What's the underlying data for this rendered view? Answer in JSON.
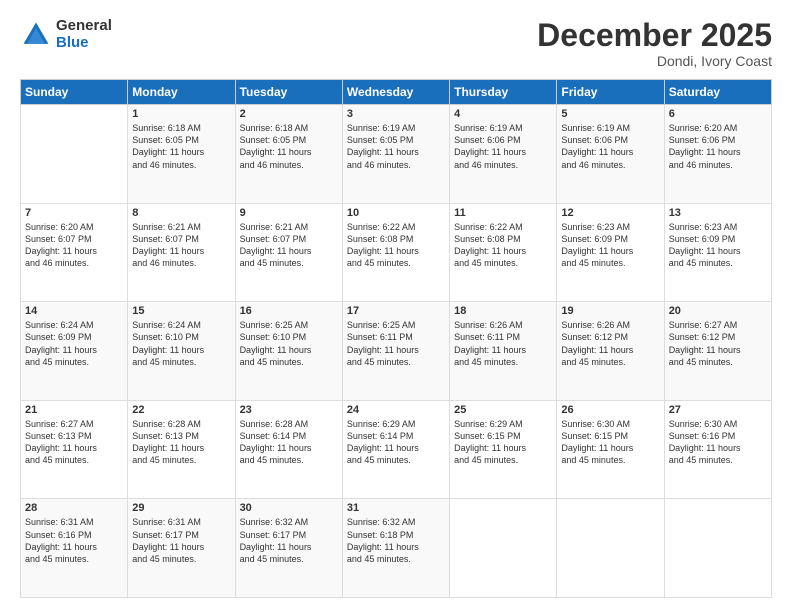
{
  "logo": {
    "general": "General",
    "blue": "Blue"
  },
  "title": "December 2025",
  "location": "Dondi, Ivory Coast",
  "days_of_week": [
    "Sunday",
    "Monday",
    "Tuesday",
    "Wednesday",
    "Thursday",
    "Friday",
    "Saturday"
  ],
  "weeks": [
    [
      {
        "day": "",
        "info": ""
      },
      {
        "day": "1",
        "info": "Sunrise: 6:18 AM\nSunset: 6:05 PM\nDaylight: 11 hours\nand 46 minutes."
      },
      {
        "day": "2",
        "info": "Sunrise: 6:18 AM\nSunset: 6:05 PM\nDaylight: 11 hours\nand 46 minutes."
      },
      {
        "day": "3",
        "info": "Sunrise: 6:19 AM\nSunset: 6:05 PM\nDaylight: 11 hours\nand 46 minutes."
      },
      {
        "day": "4",
        "info": "Sunrise: 6:19 AM\nSunset: 6:06 PM\nDaylight: 11 hours\nand 46 minutes."
      },
      {
        "day": "5",
        "info": "Sunrise: 6:19 AM\nSunset: 6:06 PM\nDaylight: 11 hours\nand 46 minutes."
      },
      {
        "day": "6",
        "info": "Sunrise: 6:20 AM\nSunset: 6:06 PM\nDaylight: 11 hours\nand 46 minutes."
      }
    ],
    [
      {
        "day": "7",
        "info": "Sunrise: 6:20 AM\nSunset: 6:07 PM\nDaylight: 11 hours\nand 46 minutes."
      },
      {
        "day": "8",
        "info": "Sunrise: 6:21 AM\nSunset: 6:07 PM\nDaylight: 11 hours\nand 46 minutes."
      },
      {
        "day": "9",
        "info": "Sunrise: 6:21 AM\nSunset: 6:07 PM\nDaylight: 11 hours\nand 45 minutes."
      },
      {
        "day": "10",
        "info": "Sunrise: 6:22 AM\nSunset: 6:08 PM\nDaylight: 11 hours\nand 45 minutes."
      },
      {
        "day": "11",
        "info": "Sunrise: 6:22 AM\nSunset: 6:08 PM\nDaylight: 11 hours\nand 45 minutes."
      },
      {
        "day": "12",
        "info": "Sunrise: 6:23 AM\nSunset: 6:09 PM\nDaylight: 11 hours\nand 45 minutes."
      },
      {
        "day": "13",
        "info": "Sunrise: 6:23 AM\nSunset: 6:09 PM\nDaylight: 11 hours\nand 45 minutes."
      }
    ],
    [
      {
        "day": "14",
        "info": "Sunrise: 6:24 AM\nSunset: 6:09 PM\nDaylight: 11 hours\nand 45 minutes."
      },
      {
        "day": "15",
        "info": "Sunrise: 6:24 AM\nSunset: 6:10 PM\nDaylight: 11 hours\nand 45 minutes."
      },
      {
        "day": "16",
        "info": "Sunrise: 6:25 AM\nSunset: 6:10 PM\nDaylight: 11 hours\nand 45 minutes."
      },
      {
        "day": "17",
        "info": "Sunrise: 6:25 AM\nSunset: 6:11 PM\nDaylight: 11 hours\nand 45 minutes."
      },
      {
        "day": "18",
        "info": "Sunrise: 6:26 AM\nSunset: 6:11 PM\nDaylight: 11 hours\nand 45 minutes."
      },
      {
        "day": "19",
        "info": "Sunrise: 6:26 AM\nSunset: 6:12 PM\nDaylight: 11 hours\nand 45 minutes."
      },
      {
        "day": "20",
        "info": "Sunrise: 6:27 AM\nSunset: 6:12 PM\nDaylight: 11 hours\nand 45 minutes."
      }
    ],
    [
      {
        "day": "21",
        "info": "Sunrise: 6:27 AM\nSunset: 6:13 PM\nDaylight: 11 hours\nand 45 minutes."
      },
      {
        "day": "22",
        "info": "Sunrise: 6:28 AM\nSunset: 6:13 PM\nDaylight: 11 hours\nand 45 minutes."
      },
      {
        "day": "23",
        "info": "Sunrise: 6:28 AM\nSunset: 6:14 PM\nDaylight: 11 hours\nand 45 minutes."
      },
      {
        "day": "24",
        "info": "Sunrise: 6:29 AM\nSunset: 6:14 PM\nDaylight: 11 hours\nand 45 minutes."
      },
      {
        "day": "25",
        "info": "Sunrise: 6:29 AM\nSunset: 6:15 PM\nDaylight: 11 hours\nand 45 minutes."
      },
      {
        "day": "26",
        "info": "Sunrise: 6:30 AM\nSunset: 6:15 PM\nDaylight: 11 hours\nand 45 minutes."
      },
      {
        "day": "27",
        "info": "Sunrise: 6:30 AM\nSunset: 6:16 PM\nDaylight: 11 hours\nand 45 minutes."
      }
    ],
    [
      {
        "day": "28",
        "info": "Sunrise: 6:31 AM\nSunset: 6:16 PM\nDaylight: 11 hours\nand 45 minutes."
      },
      {
        "day": "29",
        "info": "Sunrise: 6:31 AM\nSunset: 6:17 PM\nDaylight: 11 hours\nand 45 minutes."
      },
      {
        "day": "30",
        "info": "Sunrise: 6:32 AM\nSunset: 6:17 PM\nDaylight: 11 hours\nand 45 minutes."
      },
      {
        "day": "31",
        "info": "Sunrise: 6:32 AM\nSunset: 6:18 PM\nDaylight: 11 hours\nand 45 minutes."
      },
      {
        "day": "",
        "info": ""
      },
      {
        "day": "",
        "info": ""
      },
      {
        "day": "",
        "info": ""
      }
    ]
  ]
}
